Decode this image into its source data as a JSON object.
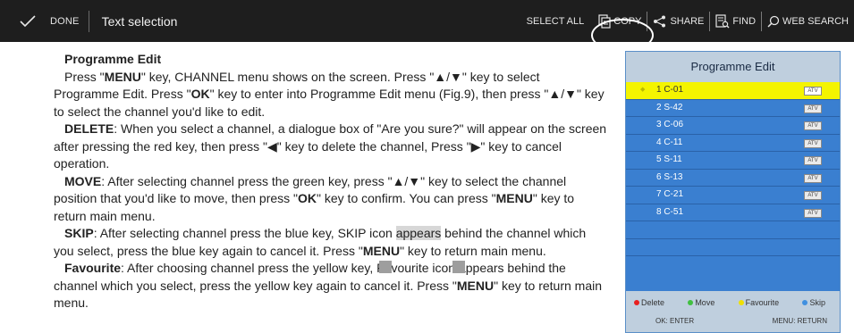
{
  "toolbar": {
    "done_label": "DONE",
    "title": "Text selection",
    "select_all": "SELECT ALL",
    "copy": "COPY",
    "share": "SHARE",
    "find": "FIND",
    "web_search": "WEB SEARCH"
  },
  "document": {
    "heading": "Programme Edit",
    "p1": {
      "t1": "Press \"",
      "b1": "MENU",
      "t2": "\" key, CHANNEL menu shows on the screen. Press \"▲/▼\" key to select Programme Edit. Press \"",
      "b2": "OK",
      "t3": "\" key to enter into Programme Edit menu (Fig.9), then press \"▲/▼\" key to select the channel you'd like to edit."
    },
    "p2": {
      "b1": "DELETE",
      "t1": ": When you select a channel, a dialogue box of \"Are you sure?\" will appear on the screen after pressing the red key, then press \"◀\" key to delete the channel, Press \"▶\" key to cancel operation."
    },
    "p3": {
      "b1": "MOVE",
      "t1": ": After selecting channel press the green key, press \"▲/▼\" key to select the channel position that you'd like to move, then press \"",
      "b2": "OK",
      "t2": "\" key to confirm. You can press \"",
      "b3": "MENU",
      "t3": "\" key to return main menu."
    },
    "p4": {
      "b1": "SKIP",
      "t1": ": After selecting channel press the blue key, SKIP icon ",
      "sel": "appears",
      "t2": " behind the channel which you select, press the blue key again to cancel it. Press \"",
      "b2": "MENU",
      "t3": "\" key to return main menu."
    },
    "p5": {
      "b1": "Favourite",
      "t1": ": After choosing channel press the yellow key, Favourite icon appears behind the channel which you select, press the yellow key again to cancel it. Press \"",
      "b2": "MENU",
      "t2": "\" key to return main menu."
    }
  },
  "tv_menu": {
    "title": "Programme Edit",
    "channels": [
      {
        "label": "1 C-01",
        "badge": "ATV"
      },
      {
        "label": "2 S-42",
        "badge": "ATV"
      },
      {
        "label": "3 C-06",
        "badge": "ATV"
      },
      {
        "label": "4 C-11",
        "badge": "ATV"
      },
      {
        "label": "5 S-11",
        "badge": "ATV"
      },
      {
        "label": "6 S-13",
        "badge": "ATV"
      },
      {
        "label": "7 C-21",
        "badge": "ATV"
      },
      {
        "label": "8 C-51",
        "badge": "ATV"
      }
    ],
    "legend": {
      "delete": "Delete",
      "move": "Move",
      "favourite": "Favourite",
      "skip": "Skip"
    },
    "ok_key": "OK: ENTER",
    "menu_key": "MENU: RETURN"
  }
}
